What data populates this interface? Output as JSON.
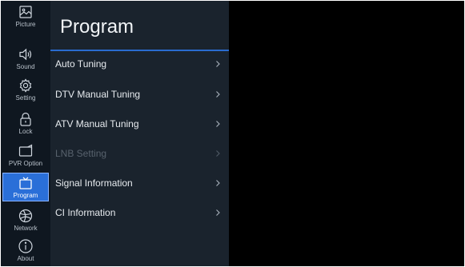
{
  "sidebar": {
    "items": [
      {
        "label": "Picture",
        "icon": "picture-icon"
      },
      {
        "label": "Sound",
        "icon": "speaker-icon"
      },
      {
        "label": "Setting",
        "icon": "gear-icon"
      },
      {
        "label": "Lock",
        "icon": "lock-icon"
      },
      {
        "label": "PVR Option",
        "icon": "record-icon"
      },
      {
        "label": "Program",
        "icon": "tv-icon",
        "active": true
      },
      {
        "label": "Network",
        "icon": "globe-icon"
      },
      {
        "label": "About",
        "icon": "info-icon"
      }
    ]
  },
  "panel": {
    "title": "Program",
    "items": [
      {
        "label": "Auto Tuning",
        "enabled": true
      },
      {
        "label": "DTV Manual Tuning",
        "enabled": true
      },
      {
        "label": "ATV Manual Tuning",
        "enabled": true
      },
      {
        "label": "LNB Setting",
        "enabled": false
      },
      {
        "label": "Signal Information",
        "enabled": true
      },
      {
        "label": "CI Information",
        "enabled": true
      }
    ]
  },
  "colors": {
    "sidebar_bg": "#0f1720",
    "panel_bg": "#1a232d",
    "accent": "#2a6fd8",
    "divider": "#2a6cd0",
    "disabled_text": "#58626d"
  }
}
